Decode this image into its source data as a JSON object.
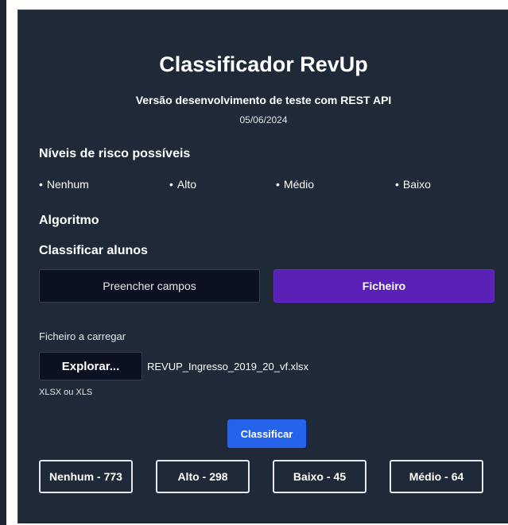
{
  "header": {
    "title": "Classificador RevUp",
    "subtitle": "Versão desenvolvimento de teste com REST API",
    "date": "05/06/2024"
  },
  "risk_levels": {
    "heading": "Níveis de risco possíveis",
    "items": [
      "Nenhum",
      "Alto",
      "Médio",
      "Baixo"
    ]
  },
  "algorithm": {
    "heading": "Algoritmo"
  },
  "classify": {
    "heading": "Classificar alunos",
    "modes": {
      "manual": "Preencher campos",
      "file": "Ficheiro"
    },
    "selected_mode": "Ficheiro"
  },
  "upload": {
    "label": "Ficheiro a carregar",
    "browse_label": "Explorar...",
    "file_name": "REVUP_Ingresso_2019_20_vf.xlsx",
    "hint": "XLSX ou XLS"
  },
  "action": {
    "classify_label": "Classificar"
  },
  "results": [
    {
      "label": "Nenhum - ",
      "count": "773"
    },
    {
      "label": "Alto - ",
      "count": "298"
    },
    {
      "label": "Baixo - ",
      "count": "45"
    },
    {
      "label": "Médio - ",
      "count": "64"
    }
  ],
  "colors": {
    "card_bg": "#1f2937",
    "accent_purple": "#5b21b6",
    "accent_blue": "#2563eb",
    "dark_button": "#0b1120"
  }
}
